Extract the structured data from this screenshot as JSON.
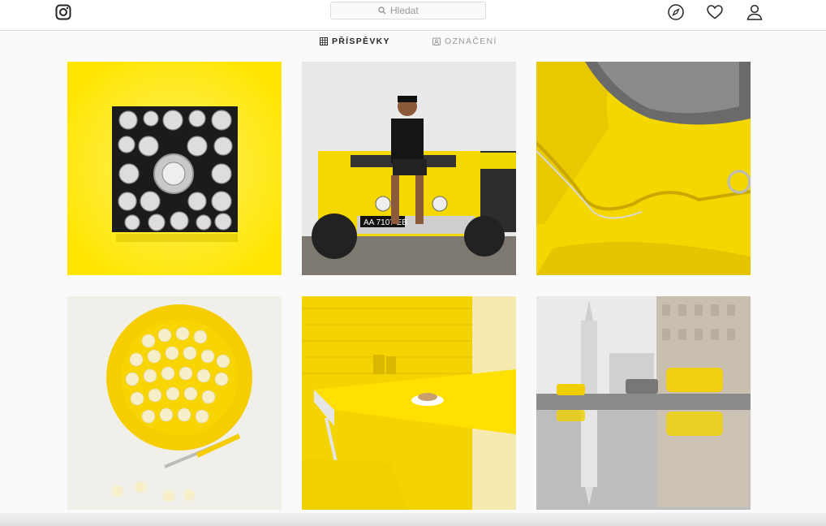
{
  "header": {
    "logo_icon": "instagram-icon",
    "search": {
      "placeholder": "Hledat",
      "icon": "search-icon"
    },
    "nav": [
      {
        "name": "explore",
        "icon": "compass-icon"
      },
      {
        "name": "activity",
        "icon": "heart-icon"
      },
      {
        "name": "profile",
        "icon": "user-icon"
      }
    ]
  },
  "tabs": [
    {
      "label": "PŘÍSPĚVKY",
      "icon": "grid-icon",
      "active": true
    },
    {
      "label": "OZNAČENÍ",
      "icon": "tag-icon",
      "active": false
    }
  ],
  "colors": {
    "accent_yellow": "#ffe600",
    "border": "#dbdbdb",
    "text": "#262626",
    "muted": "#999999"
  },
  "posts": [
    {
      "id": "post-1",
      "subject": "metal cutters on yellow"
    },
    {
      "id": "post-2",
      "subject": "man on yellow jeep"
    },
    {
      "id": "post-3",
      "subject": "yellow beetle detail"
    },
    {
      "id": "post-4",
      "subject": "dumplings on yellow plate"
    },
    {
      "id": "post-5",
      "subject": "yellow cafe table"
    },
    {
      "id": "post-6",
      "subject": "yellow taxi reflection"
    }
  ],
  "jeep_plate": "AA 7107 EB"
}
